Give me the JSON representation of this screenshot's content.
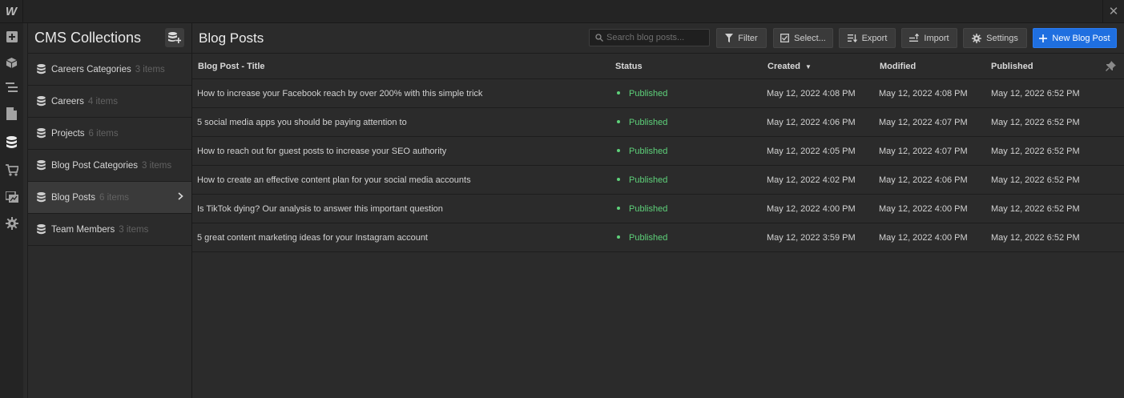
{
  "app": {
    "logo": "W"
  },
  "sidebar": {
    "title": "CMS Collections",
    "items": [
      {
        "label": "Careers Categories",
        "count": "3 items",
        "selected": false
      },
      {
        "label": "Careers",
        "count": "4 items",
        "selected": false
      },
      {
        "label": "Projects",
        "count": "6 items",
        "selected": false
      },
      {
        "label": "Blog Post Categories",
        "count": "3 items",
        "selected": false
      },
      {
        "label": "Blog Posts",
        "count": "6 items",
        "selected": true
      },
      {
        "label": "Team Members",
        "count": "3 items",
        "selected": false
      }
    ]
  },
  "main": {
    "title": "Blog Posts",
    "search_placeholder": "Search blog posts...",
    "toolbar": {
      "filter": "Filter",
      "select": "Select...",
      "export": "Export",
      "import": "Import",
      "settings": "Settings",
      "new": "New Blog Post"
    },
    "columns": {
      "title": "Blog Post - Title",
      "status": "Status",
      "created": "Created",
      "modified": "Modified",
      "published": "Published"
    },
    "rows": [
      {
        "title": "How to increase your Facebook reach by over 200% with this simple trick",
        "status": "Published",
        "created": "May 12, 2022 4:08 PM",
        "modified": "May 12, 2022 4:08 PM",
        "published": "May 12, 2022 6:52 PM"
      },
      {
        "title": "5 social media apps you should be paying attention to",
        "status": "Published",
        "created": "May 12, 2022 4:06 PM",
        "modified": "May 12, 2022 4:07 PM",
        "published": "May 12, 2022 6:52 PM"
      },
      {
        "title": "How to reach out for guest posts to increase your SEO authority",
        "status": "Published",
        "created": "May 12, 2022 4:05 PM",
        "modified": "May 12, 2022 4:07 PM",
        "published": "May 12, 2022 6:52 PM"
      },
      {
        "title": "How to create an effective content plan for your social media accounts",
        "status": "Published",
        "created": "May 12, 2022 4:02 PM",
        "modified": "May 12, 2022 4:06 PM",
        "published": "May 12, 2022 6:52 PM"
      },
      {
        "title": "Is TikTok dying? Our analysis to answer this important question",
        "status": "Published",
        "created": "May 12, 2022 4:00 PM",
        "modified": "May 12, 2022 4:00 PM",
        "published": "May 12, 2022 6:52 PM"
      },
      {
        "title": "5 great content marketing ideas for your Instagram account",
        "status": "Published",
        "created": "May 12, 2022 3:59 PM",
        "modified": "May 12, 2022 4:00 PM",
        "published": "May 12, 2022 6:52 PM"
      }
    ]
  },
  "colors": {
    "accent": "#1f6fe0",
    "published": "#5ed17a",
    "background": "#2b2b2b"
  },
  "icons": {
    "rail": [
      "add-panel-icon",
      "components-icon",
      "navigator-icon",
      "pages-icon",
      "cms-icon",
      "ecommerce-icon",
      "assets-icon",
      "settings-icon"
    ],
    "toolbar": [
      "search-icon",
      "filter-icon",
      "select-icon",
      "export-icon",
      "import-icon",
      "gear-icon",
      "plus-icon"
    ]
  }
}
